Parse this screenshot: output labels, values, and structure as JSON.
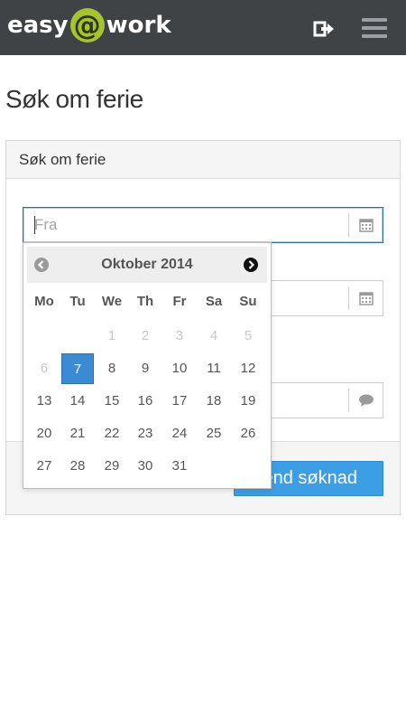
{
  "header": {
    "logo": {
      "left": "easy",
      "at": "@",
      "right": "work"
    },
    "logout_icon": "sign-out-icon",
    "menu_icon": "hamburger-menu-icon"
  },
  "page": {
    "title": "Søk om ferie"
  },
  "panel": {
    "heading": "Søk om ferie",
    "fields": {
      "from": {
        "placeholder": "Fra",
        "icon": "calendar-icon"
      },
      "to": {
        "icon": "calendar-icon"
      },
      "comment": {
        "icon": "comment-icon"
      }
    },
    "submit_label": "end søknad"
  },
  "datepicker": {
    "month_title": "Oktober 2014",
    "prev_icon": "chevron-left-circle-icon",
    "next_icon": "chevron-right-circle-icon",
    "weekdays": [
      "Mo",
      "Tu",
      "We",
      "Th",
      "Fr",
      "Sa",
      "Su"
    ],
    "weeks": [
      [
        "",
        "",
        "1",
        "2",
        "3",
        "4",
        "5"
      ],
      [
        "6",
        "7",
        "8",
        "9",
        "10",
        "11",
        "12"
      ],
      [
        "13",
        "14",
        "15",
        "16",
        "17",
        "18",
        "19"
      ],
      [
        "20",
        "21",
        "22",
        "23",
        "24",
        "25",
        "26"
      ],
      [
        "27",
        "28",
        "29",
        "30",
        "31",
        "",
        ""
      ]
    ],
    "disabled_days": [
      "1",
      "2",
      "3",
      "4",
      "5",
      "6"
    ],
    "selected_day": "7"
  },
  "colors": {
    "topbar": "#3f4346",
    "logo_accent": "#a6c431",
    "selected_day": "#3b8bd4",
    "primary_button": "#3c9ee5"
  }
}
